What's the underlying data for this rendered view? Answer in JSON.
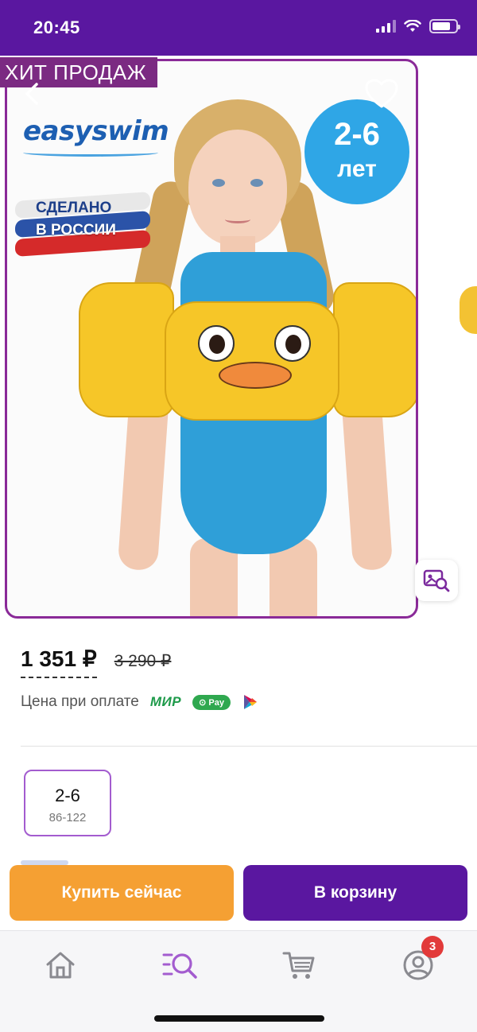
{
  "status_bar": {
    "time": "20:45"
  },
  "product": {
    "badge": "ХИТ ПРОДАЖ",
    "brand_logo_text": "easyswim",
    "made_in_line1": "СДЕЛАНО",
    "made_in_line2": "В РОССИИ",
    "age_range": "2-6",
    "age_unit": "лет",
    "price_current": "1 351 ₽",
    "price_old": "3 290 ₽",
    "payment_label": "Цена при оплате",
    "payment_methods": [
      "МИР",
      "Pay"
    ]
  },
  "sizes": [
    {
      "label": "2-6",
      "sub": "86-122"
    }
  ],
  "actions": {
    "buy_now": "Купить сейчас",
    "add_to_cart": "В корзину"
  },
  "tabbar": {
    "items": [
      {
        "name": "home",
        "icon": "home-icon"
      },
      {
        "name": "catalog",
        "icon": "search-catalog-icon"
      },
      {
        "name": "cart",
        "icon": "cart-icon"
      },
      {
        "name": "profile",
        "icon": "user-icon"
      }
    ],
    "profile_badge": "3"
  },
  "colors": {
    "brand_purple": "#5a17a0",
    "accent_orange": "#f5a033",
    "badge_red": "#e23a3a",
    "age_blue": "#2fa6e6",
    "mir_green": "#1e9a4a"
  }
}
